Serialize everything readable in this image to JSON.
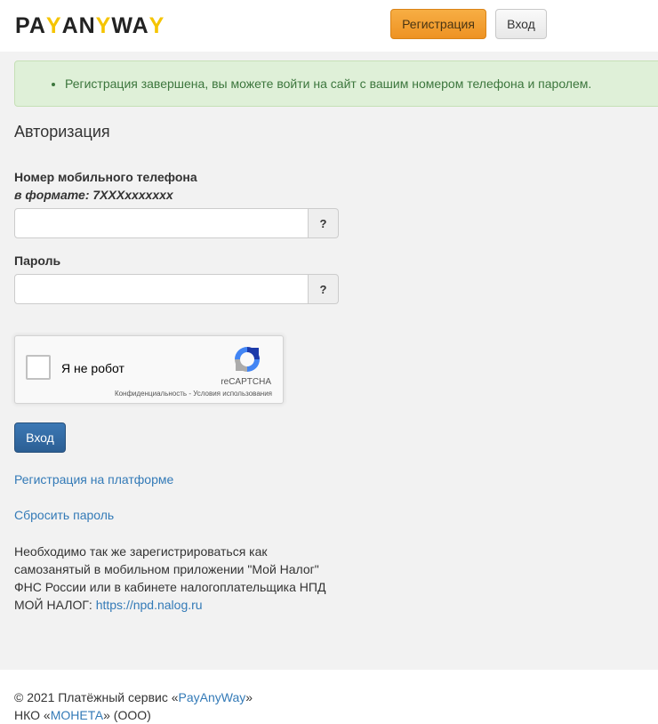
{
  "header": {
    "logo": {
      "part1": "PA",
      "part2": "Y",
      "part3": "AN",
      "part4": "Y",
      "part5": "WA",
      "part6": "Y",
      "yellow_color": "#f5c400"
    },
    "register_label": "Регистрация",
    "login_label": "Вход"
  },
  "alert": {
    "message": "Регистрация завершена, вы можете войти на сайт с вашим номером телефона и паролем."
  },
  "form": {
    "title": "Авторизация",
    "phone": {
      "label": "Номер мобильного телефона",
      "format_hint": "в формате: 7XXXxxxxxxx",
      "value": "",
      "help": "?"
    },
    "password": {
      "label": "Пароль",
      "value": "",
      "help": "?"
    },
    "captcha": {
      "label": "Я не робот",
      "brand": "reCAPTCHA",
      "privacy": "Конфиденциальность",
      "separator": " - ",
      "terms": "Условия использования"
    },
    "submit_label": "Вход"
  },
  "links": {
    "register_platform": "Регистрация на платформе",
    "reset_password": "Сбросить пароль"
  },
  "note": {
    "text": "Необходимо так же зарегистрироваться как самозанятый в мобильном приложении \"Мой Налог\" ФНС России или в кабинете налогоплательщика НПД МОЙ НАЛОГ: ",
    "link": "https://npd.nalog.ru"
  },
  "footer": {
    "copyright_prefix": "© 2021 Платёжный сервис «",
    "service_link": "PayAnyWay",
    "copyright_suffix": "»",
    "org_prefix": "НКО «",
    "org_link": "МОНЕТА",
    "org_suffix": "» (ООО)"
  },
  "colors": {
    "accent_orange": "#ee9222",
    "primary_blue": "#2c5f94",
    "link_blue": "#337ab7",
    "success_bg": "#dff0d8",
    "success_text": "#3c763d"
  }
}
